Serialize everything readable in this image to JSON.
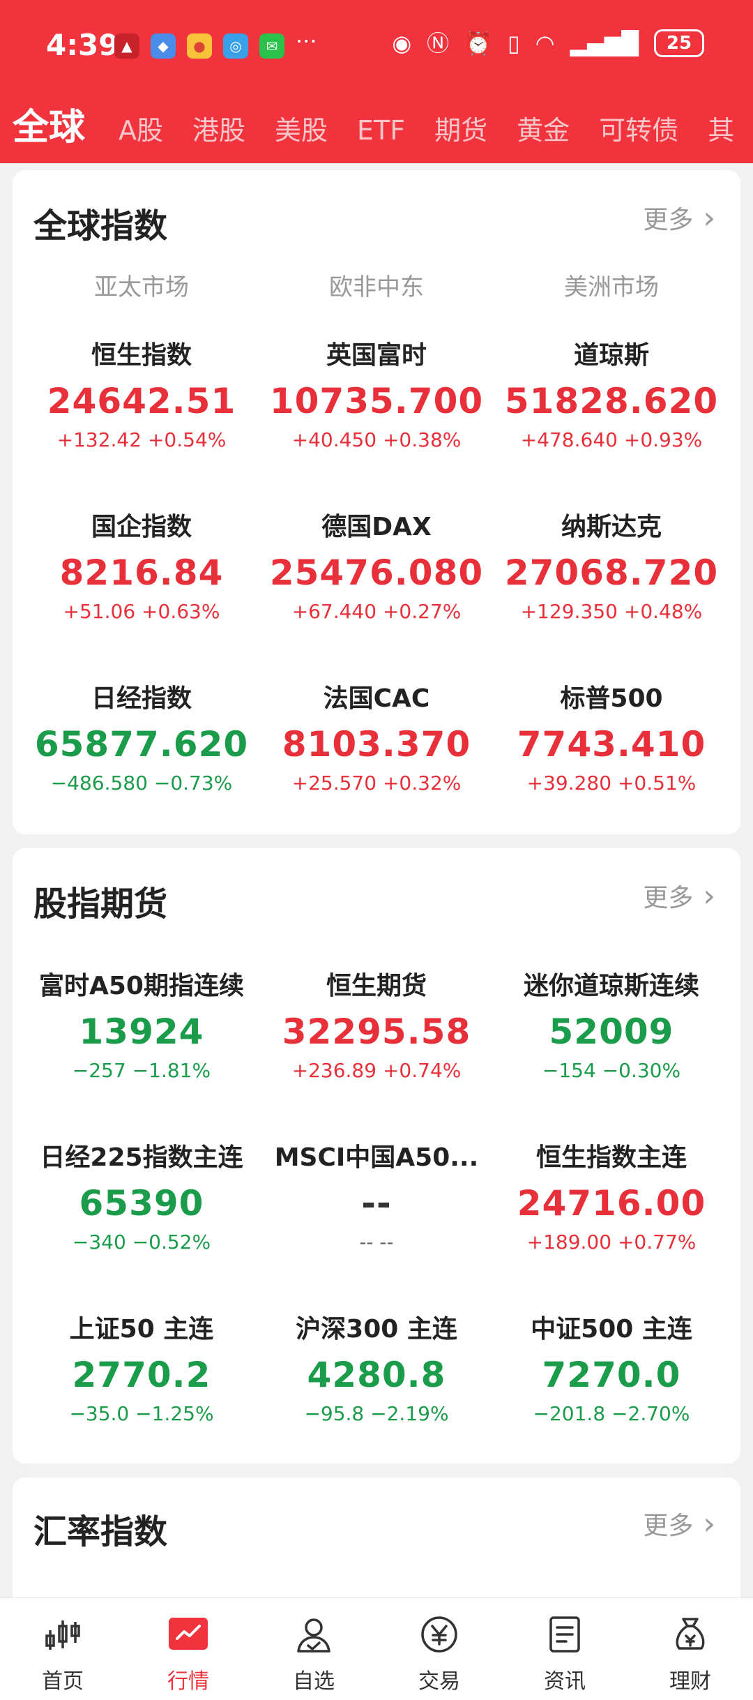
{
  "status_bar": {
    "time": "4:39",
    "dots": "···",
    "battery": "25"
  },
  "tabs": [
    "全球",
    "A股",
    "港股",
    "美股",
    "ETF",
    "期货",
    "黄金",
    "可转债",
    "其"
  ],
  "global_indices": {
    "title": "全球指数",
    "more": "更多",
    "regions": [
      "亚太市场",
      "欧非中东",
      "美洲市场"
    ],
    "items": [
      {
        "name": "恒生指数",
        "value": "24642.51",
        "change": "+132.42 +0.54%",
        "dir": "up"
      },
      {
        "name": "英国富时",
        "value": "10735.700",
        "change": "+40.450 +0.38%",
        "dir": "up"
      },
      {
        "name": "道琼斯",
        "value": "51828.620",
        "change": "+478.640 +0.93%",
        "dir": "up"
      },
      {
        "name": "国企指数",
        "value": "8216.84",
        "change": "+51.06 +0.63%",
        "dir": "up"
      },
      {
        "name": "德国DAX",
        "value": "25476.080",
        "change": "+67.440 +0.27%",
        "dir": "up"
      },
      {
        "name": "纳斯达克",
        "value": "27068.720",
        "change": "+129.350 +0.48%",
        "dir": "up"
      },
      {
        "name": "日经指数",
        "value": "65877.620",
        "change": "−486.580 −0.73%",
        "dir": "down"
      },
      {
        "name": "法国CAC",
        "value": "8103.370",
        "change": "+25.570 +0.32%",
        "dir": "up"
      },
      {
        "name": "标普500",
        "value": "7743.410",
        "change": "+39.280 +0.51%",
        "dir": "up"
      }
    ]
  },
  "index_futures": {
    "title": "股指期货",
    "more": "更多",
    "items": [
      {
        "name": "富时A50期指连续",
        "value": "13924",
        "change": "−257 −1.81%",
        "dir": "down"
      },
      {
        "name": "恒生期货",
        "value": "32295.58",
        "change": "+236.89 +0.74%",
        "dir": "up"
      },
      {
        "name": "迷你道琼斯连续",
        "value": "52009",
        "change": "−154 −0.30%",
        "dir": "down"
      },
      {
        "name": "日经225指数主连",
        "value": "65390",
        "change": "−340 −0.52%",
        "dir": "down"
      },
      {
        "name": "MSCI中国A50...",
        "value": "--",
        "change": "-- --",
        "dir": "flat"
      },
      {
        "name": "恒生指数主连",
        "value": "24716.00",
        "change": "+189.00 +0.77%",
        "dir": "up"
      },
      {
        "name": "上证50 主连",
        "value": "2770.2",
        "change": "−35.0 −1.25%",
        "dir": "down"
      },
      {
        "name": "沪深300 主连",
        "value": "4280.8",
        "change": "−95.8 −2.19%",
        "dir": "down"
      },
      {
        "name": "中证500 主连",
        "value": "7270.0",
        "change": "−201.8 −2.70%",
        "dir": "down"
      }
    ]
  },
  "fx_index": {
    "title": "汇率指数",
    "more": "更多"
  },
  "bottom_nav": [
    {
      "label": "首页",
      "icon": "candlestick-icon",
      "active": false
    },
    {
      "label": "行情",
      "icon": "market-chart-icon",
      "active": true
    },
    {
      "label": "自选",
      "icon": "user-check-icon",
      "active": false
    },
    {
      "label": "交易",
      "icon": "yuan-icon",
      "active": false
    },
    {
      "label": "资讯",
      "icon": "document-icon",
      "active": false
    },
    {
      "label": "理财",
      "icon": "money-bag-icon",
      "active": false
    }
  ],
  "colors": {
    "brand_red": "#f0333d",
    "up": "#e8303a",
    "down": "#1a9c4b"
  }
}
